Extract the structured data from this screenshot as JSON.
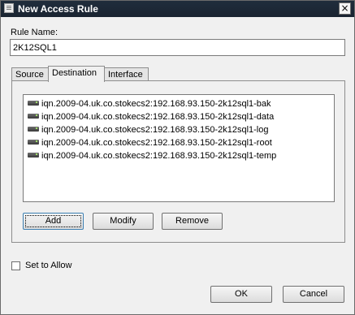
{
  "window": {
    "title": "New Access Rule",
    "close_glyph": "×"
  },
  "rule_name": {
    "label": "Rule Name:",
    "value": "2K12SQL1"
  },
  "tabs": [
    {
      "label": "Source",
      "active": false
    },
    {
      "label": "Destination",
      "active": true
    },
    {
      "label": "Interface",
      "active": false
    }
  ],
  "destination_list": {
    "items": [
      {
        "text": "iqn.2009-04.uk.co.stokecs2:192.168.93.150-2k12sql1-bak",
        "icon": "disk-drive-icon"
      },
      {
        "text": "iqn.2009-04.uk.co.stokecs2:192.168.93.150-2k12sql1-data",
        "icon": "disk-drive-icon"
      },
      {
        "text": "iqn.2009-04.uk.co.stokecs2:192.168.93.150-2k12sql1-log",
        "icon": "disk-drive-icon"
      },
      {
        "text": "iqn.2009-04.uk.co.stokecs2:192.168.93.150-2k12sql1-root",
        "icon": "disk-drive-icon"
      },
      {
        "text": "iqn.2009-04.uk.co.stokecs2:192.168.93.150-2k12sql1-temp",
        "icon": "disk-drive-icon"
      }
    ]
  },
  "list_buttons": {
    "add": "Add",
    "modify": "Modify",
    "remove": "Remove"
  },
  "set_to_allow": {
    "label": "Set to Allow",
    "checked": false
  },
  "dialog_buttons": {
    "ok": "OK",
    "cancel": "Cancel"
  },
  "colors": {
    "titlebar": "#1e2937",
    "dialog_bg": "#f0f0f0",
    "list_bg": "#ffffff"
  }
}
